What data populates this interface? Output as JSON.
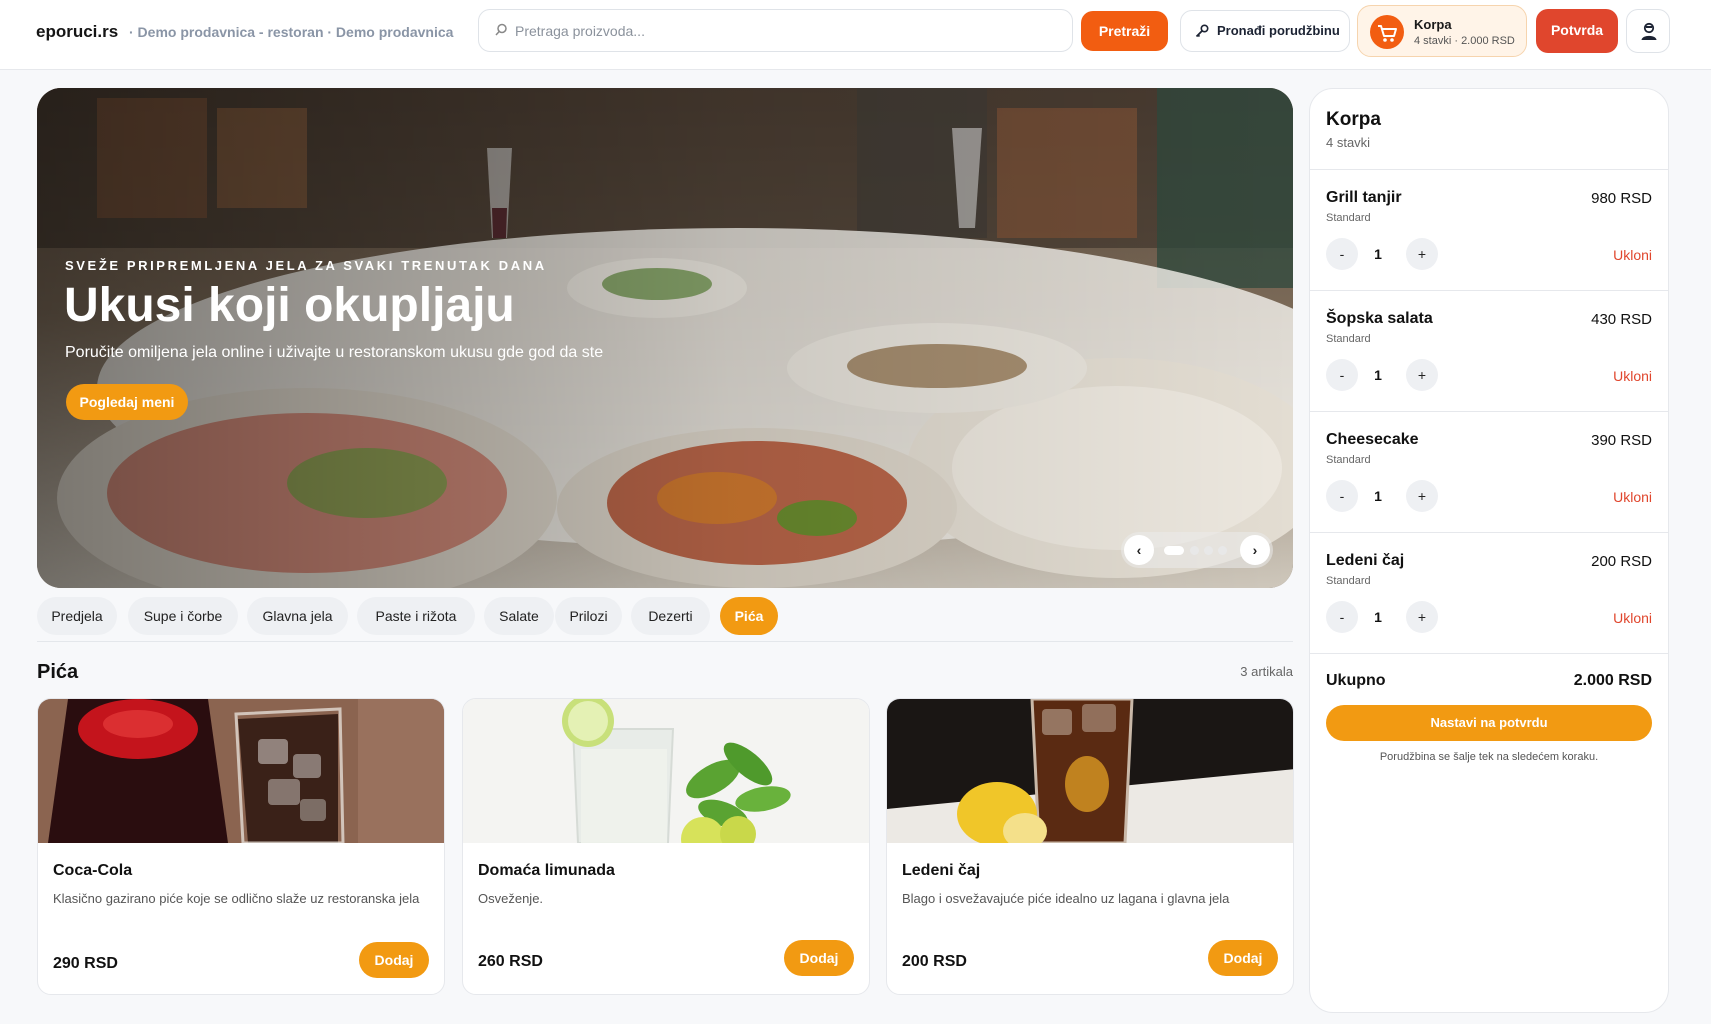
{
  "header": {
    "brand": "eporuci.rs",
    "brand_sub": "· Demo prodavnica - restoran · Demo prodavnica",
    "search_placeholder": "Pretraga proizvoda...",
    "search_button": "Pretraži",
    "find_order": "Pronađi porudžbinu",
    "cart_title": "Korpa",
    "cart_summary": "4 stavki · 2.000 RSD",
    "confirm_button": "Potvrda"
  },
  "hero": {
    "kicker": "SVEŽE PRIPREMLJENA JELA ZA SVAKI TRENUTAK DANA",
    "title": "Ukusi koji okupljaju",
    "subtitle": "Poručite omiljena jela online i uživajte u restoranskom ukusu gde god da ste",
    "cta": "Pogledaj meni",
    "prev": "‹",
    "next": "›",
    "slides": 4,
    "active_slide": 1
  },
  "categories": [
    {
      "label": "Predjela",
      "active": false
    },
    {
      "label": "Supe i čorbe",
      "active": false
    },
    {
      "label": "Glavna jela",
      "active": false
    },
    {
      "label": "Paste i rižota",
      "active": false
    },
    {
      "label": "Salate",
      "active": false
    },
    {
      "label": "Prilozi",
      "active": false
    },
    {
      "label": "Dezerti",
      "active": false
    },
    {
      "label": "Pića",
      "active": true
    }
  ],
  "section": {
    "title": "Pića",
    "count": "3 artikala"
  },
  "products": [
    {
      "name": "Coca-Cola",
      "description": "Klasično gazirano piće koje se odlično slaže uz restoranska jela",
      "price": "290 RSD",
      "add": "Dodaj"
    },
    {
      "name": "Domaća limunada",
      "description": "Osveženje.",
      "price": "260 RSD",
      "add": "Dodaj"
    },
    {
      "name": "Ledeni čaj",
      "description": "Blago i osvežavajuće piće idealno uz lagana i glavna jela",
      "price": "200 RSD",
      "add": "Dodaj"
    }
  ],
  "cart": {
    "title": "Korpa",
    "count": "4 stavki",
    "items": [
      {
        "name": "Grill tanjir",
        "variant": "Standard",
        "price": "980 RSD",
        "qty": "1",
        "minus": "-",
        "plus": "+",
        "remove": "Ukloni"
      },
      {
        "name": "Šopska salata",
        "variant": "Standard",
        "price": "430 RSD",
        "qty": "1",
        "minus": "-",
        "plus": "+",
        "remove": "Ukloni"
      },
      {
        "name": "Cheesecake",
        "variant": "Standard",
        "price": "390 RSD",
        "qty": "1",
        "minus": "-",
        "plus": "+",
        "remove": "Ukloni"
      },
      {
        "name": "Ledeni čaj",
        "variant": "Standard",
        "price": "200 RSD",
        "qty": "1",
        "minus": "-",
        "plus": "+",
        "remove": "Ukloni"
      }
    ],
    "total_label": "Ukupno",
    "total_value": "2.000 RSD",
    "cta": "Nastavi na potvrdu",
    "note": "Porudžbina se šalje tek na sledećem koraku."
  },
  "colors": {
    "accent": "#f29a12",
    "search_button": "#f25d11",
    "confirm": "#e0462d",
    "remove": "#e0462d"
  }
}
